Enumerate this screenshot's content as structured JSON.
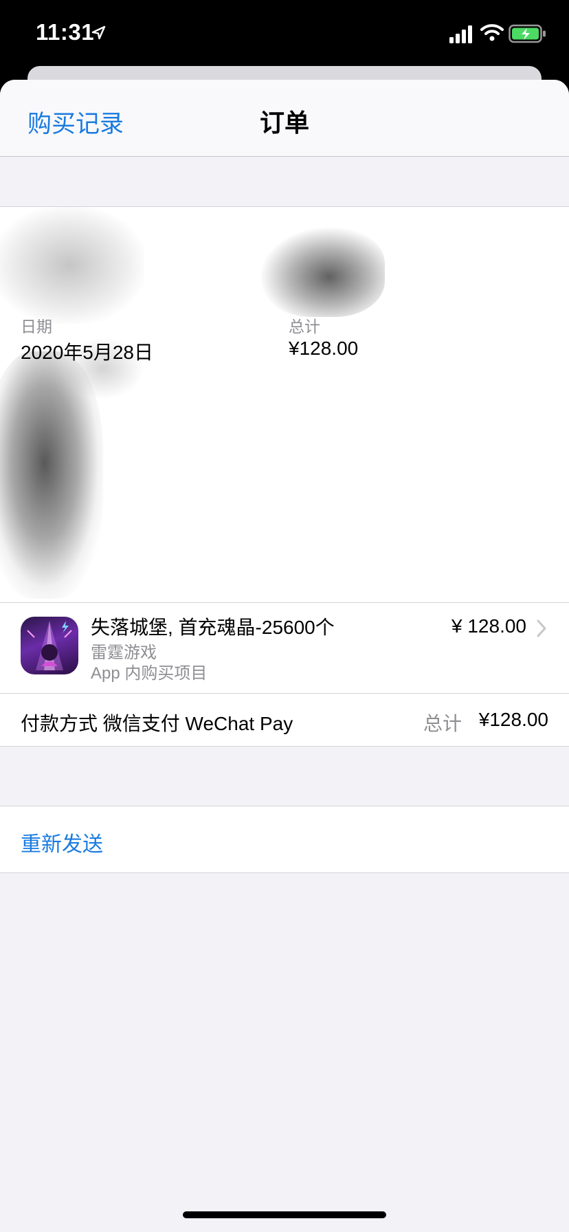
{
  "status_bar": {
    "time": "11:31",
    "icons": [
      "location-arrow-icon",
      "cellular-signal-icon",
      "wifi-icon",
      "battery-charging-icon"
    ]
  },
  "nav": {
    "back_label": "购买记录",
    "title": "订单"
  },
  "order_info": {
    "date_label": "日期",
    "date_value": "2020年5月28日",
    "total_label": "总计",
    "total_value": "¥128.00"
  },
  "item": {
    "title": "失落城堡, 首充魂晶-25600个",
    "developer": "雷霆游戏",
    "type": "App 内购买项目",
    "price": "¥ 128.00",
    "icon": "game-app-icon"
  },
  "payment": {
    "label": "付款方式 微信支付 WeChat Pay",
    "total_label": "总计",
    "total_value": "¥128.00"
  },
  "actions": {
    "resend_label": "重新发送"
  },
  "colors": {
    "accent": "#1a7be0",
    "background": "#f2f2f7",
    "secondary_text": "#8e8e93"
  }
}
